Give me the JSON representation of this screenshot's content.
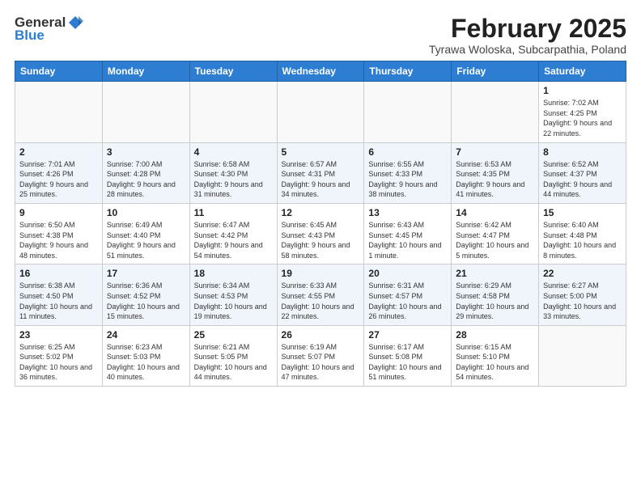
{
  "header": {
    "logo_general": "General",
    "logo_blue": "Blue",
    "month_title": "February 2025",
    "location": "Tyrawa Woloska, Subcarpathia, Poland"
  },
  "weekdays": [
    "Sunday",
    "Monday",
    "Tuesday",
    "Wednesday",
    "Thursday",
    "Friday",
    "Saturday"
  ],
  "weeks": [
    [
      {
        "day": "",
        "info": ""
      },
      {
        "day": "",
        "info": ""
      },
      {
        "day": "",
        "info": ""
      },
      {
        "day": "",
        "info": ""
      },
      {
        "day": "",
        "info": ""
      },
      {
        "day": "",
        "info": ""
      },
      {
        "day": "1",
        "info": "Sunrise: 7:02 AM\nSunset: 4:25 PM\nDaylight: 9 hours and 22 minutes."
      }
    ],
    [
      {
        "day": "2",
        "info": "Sunrise: 7:01 AM\nSunset: 4:26 PM\nDaylight: 9 hours and 25 minutes."
      },
      {
        "day": "3",
        "info": "Sunrise: 7:00 AM\nSunset: 4:28 PM\nDaylight: 9 hours and 28 minutes."
      },
      {
        "day": "4",
        "info": "Sunrise: 6:58 AM\nSunset: 4:30 PM\nDaylight: 9 hours and 31 minutes."
      },
      {
        "day": "5",
        "info": "Sunrise: 6:57 AM\nSunset: 4:31 PM\nDaylight: 9 hours and 34 minutes."
      },
      {
        "day": "6",
        "info": "Sunrise: 6:55 AM\nSunset: 4:33 PM\nDaylight: 9 hours and 38 minutes."
      },
      {
        "day": "7",
        "info": "Sunrise: 6:53 AM\nSunset: 4:35 PM\nDaylight: 9 hours and 41 minutes."
      },
      {
        "day": "8",
        "info": "Sunrise: 6:52 AM\nSunset: 4:37 PM\nDaylight: 9 hours and 44 minutes."
      }
    ],
    [
      {
        "day": "9",
        "info": "Sunrise: 6:50 AM\nSunset: 4:38 PM\nDaylight: 9 hours and 48 minutes."
      },
      {
        "day": "10",
        "info": "Sunrise: 6:49 AM\nSunset: 4:40 PM\nDaylight: 9 hours and 51 minutes."
      },
      {
        "day": "11",
        "info": "Sunrise: 6:47 AM\nSunset: 4:42 PM\nDaylight: 9 hours and 54 minutes."
      },
      {
        "day": "12",
        "info": "Sunrise: 6:45 AM\nSunset: 4:43 PM\nDaylight: 9 hours and 58 minutes."
      },
      {
        "day": "13",
        "info": "Sunrise: 6:43 AM\nSunset: 4:45 PM\nDaylight: 10 hours and 1 minute."
      },
      {
        "day": "14",
        "info": "Sunrise: 6:42 AM\nSunset: 4:47 PM\nDaylight: 10 hours and 5 minutes."
      },
      {
        "day": "15",
        "info": "Sunrise: 6:40 AM\nSunset: 4:48 PM\nDaylight: 10 hours and 8 minutes."
      }
    ],
    [
      {
        "day": "16",
        "info": "Sunrise: 6:38 AM\nSunset: 4:50 PM\nDaylight: 10 hours and 11 minutes."
      },
      {
        "day": "17",
        "info": "Sunrise: 6:36 AM\nSunset: 4:52 PM\nDaylight: 10 hours and 15 minutes."
      },
      {
        "day": "18",
        "info": "Sunrise: 6:34 AM\nSunset: 4:53 PM\nDaylight: 10 hours and 19 minutes."
      },
      {
        "day": "19",
        "info": "Sunrise: 6:33 AM\nSunset: 4:55 PM\nDaylight: 10 hours and 22 minutes."
      },
      {
        "day": "20",
        "info": "Sunrise: 6:31 AM\nSunset: 4:57 PM\nDaylight: 10 hours and 26 minutes."
      },
      {
        "day": "21",
        "info": "Sunrise: 6:29 AM\nSunset: 4:58 PM\nDaylight: 10 hours and 29 minutes."
      },
      {
        "day": "22",
        "info": "Sunrise: 6:27 AM\nSunset: 5:00 PM\nDaylight: 10 hours and 33 minutes."
      }
    ],
    [
      {
        "day": "23",
        "info": "Sunrise: 6:25 AM\nSunset: 5:02 PM\nDaylight: 10 hours and 36 minutes."
      },
      {
        "day": "24",
        "info": "Sunrise: 6:23 AM\nSunset: 5:03 PM\nDaylight: 10 hours and 40 minutes."
      },
      {
        "day": "25",
        "info": "Sunrise: 6:21 AM\nSunset: 5:05 PM\nDaylight: 10 hours and 44 minutes."
      },
      {
        "day": "26",
        "info": "Sunrise: 6:19 AM\nSunset: 5:07 PM\nDaylight: 10 hours and 47 minutes."
      },
      {
        "day": "27",
        "info": "Sunrise: 6:17 AM\nSunset: 5:08 PM\nDaylight: 10 hours and 51 minutes."
      },
      {
        "day": "28",
        "info": "Sunrise: 6:15 AM\nSunset: 5:10 PM\nDaylight: 10 hours and 54 minutes."
      },
      {
        "day": "",
        "info": ""
      }
    ]
  ]
}
